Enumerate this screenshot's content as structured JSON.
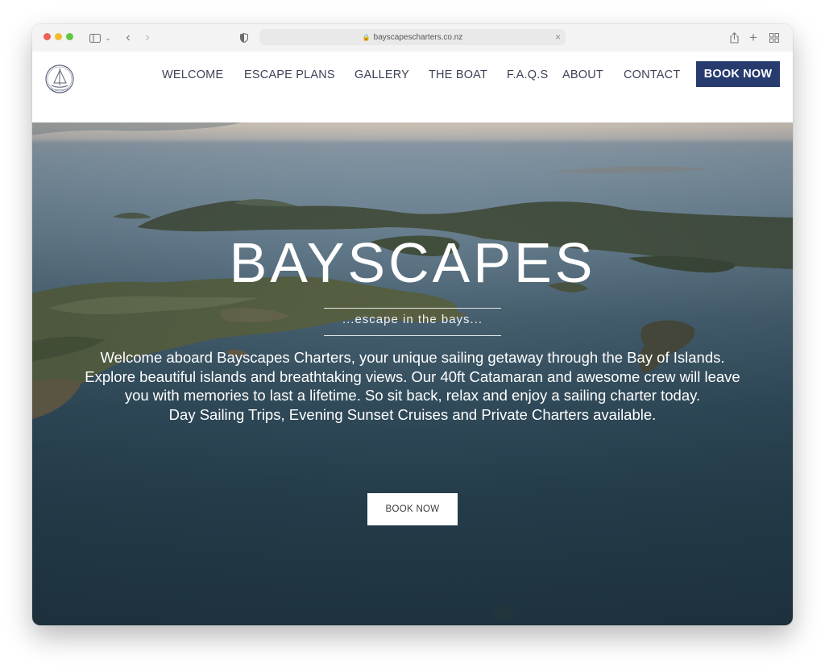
{
  "browser": {
    "url": "bayscapescharters.co.nz"
  },
  "site": {
    "logo_text": "BAYSCAPES",
    "nav": [
      {
        "label": "WELCOME"
      },
      {
        "label": "ESCAPE PLANS"
      },
      {
        "label": "GALLERY"
      },
      {
        "label": "THE BOAT"
      },
      {
        "label": "F.A.Q.S"
      },
      {
        "label": "ABOUT"
      },
      {
        "label": "CONTACT"
      }
    ],
    "book_now_label": "BOOK NOW"
  },
  "hero": {
    "title": "BAYSCAPES",
    "tagline": "...escape in the bays...",
    "paragraphs": [
      "Welcome aboard Bayscapes Charters, your unique sailing getaway through the Bay of Islands.",
      "Explore beautiful islands and breathtaking views. Our 40ft Catamaran and awesome crew will leave you with memories to last a lifetime. So sit back, relax and enjoy a sailing charter today.",
      "Day Sailing Trips, Evening Sunset Cruises and Private Charters available."
    ],
    "cta_label": "BOOK NOW"
  },
  "colors": {
    "brand_navy": "#283b6e",
    "nav_text": "#3b4256"
  }
}
